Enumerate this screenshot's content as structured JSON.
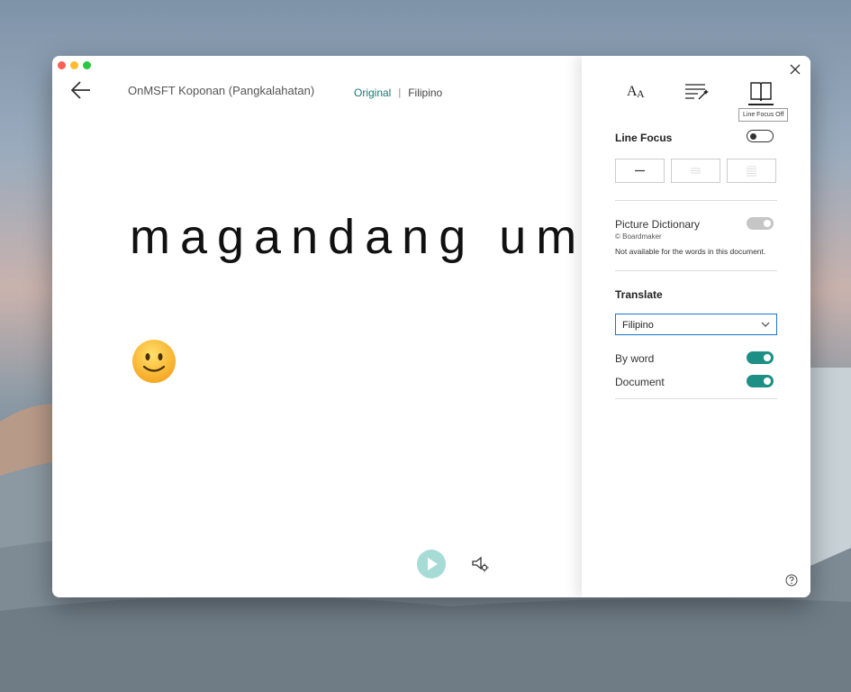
{
  "window": {
    "doc_title": "OnMSFT Koponan (Pangkalahatan)",
    "tabs": {
      "original": "Original",
      "separator": "|",
      "translated": "Filipino"
    },
    "reading_text": "magandang umaga",
    "emoji": "slightly-smiling-face"
  },
  "panel": {
    "tabs": [
      "text-preferences-icon",
      "grammar-options-icon",
      "reading-preferences-icon"
    ],
    "active_tab": "reading-preferences",
    "tooltip": "Line Focus Off",
    "line_focus": {
      "label": "Line Focus",
      "on": false
    },
    "picture_dictionary": {
      "label": "Picture Dictionary",
      "credit": "© Boardmaker",
      "note": "Not available for the words in this document."
    },
    "translate": {
      "label": "Translate",
      "language": "Filipino",
      "by_word_label": "By word",
      "by_word_on": true,
      "document_label": "Document",
      "document_on": true
    }
  },
  "colors": {
    "accent": "#1e8f84",
    "tab_active": "#1a7a6e",
    "focus_border": "#1a73c8"
  }
}
